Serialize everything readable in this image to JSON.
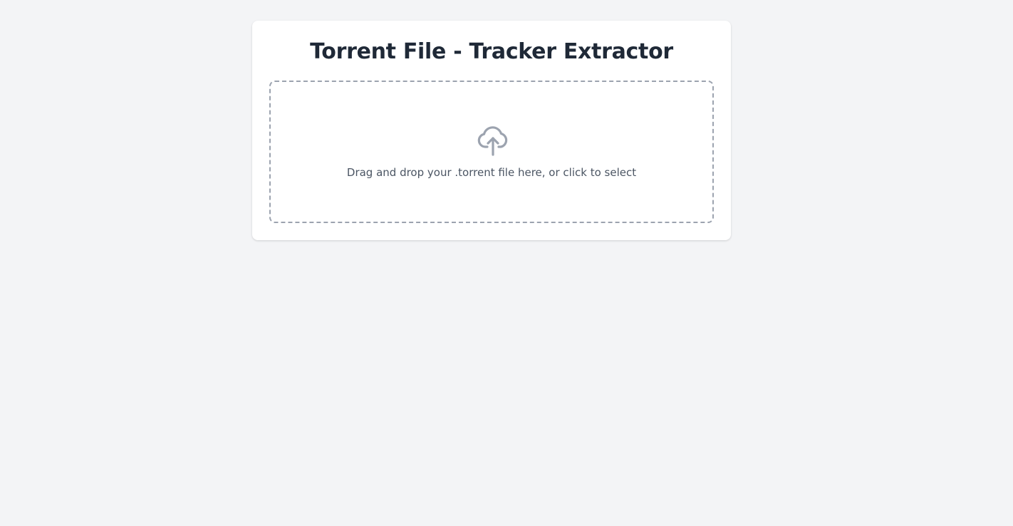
{
  "page": {
    "title": "Torrent File - Tracker Extractor"
  },
  "dropzone": {
    "icon": "cloud-upload-icon",
    "text": "Drag and drop your .torrent file here, or click to select"
  },
  "colors": {
    "background": "#f3f4f6",
    "card": "#ffffff",
    "title": "#1f2937",
    "border": "#9ca3af",
    "text": "#4b5563"
  }
}
